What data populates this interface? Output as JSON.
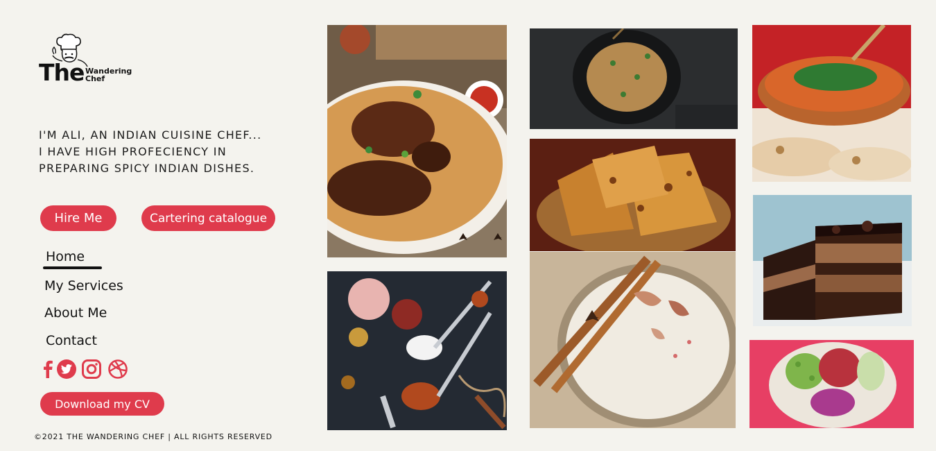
{
  "brand": {
    "line1": "The",
    "line2a": "Wandering",
    "line2b": "Chef"
  },
  "intro": {
    "line1": "I'm Ali, an Indian cuisine chef...",
    "line2": "I have high profeciency in",
    "line3": "preparing spicy Indian dishes."
  },
  "buttons": {
    "hire": "Hire Me",
    "catalogue": "Cartering catalogue",
    "cv": "Download my CV"
  },
  "nav": {
    "home": "Home",
    "services": "My Services",
    "about": "About Me",
    "contact": "Contact",
    "active": "Home"
  },
  "social": [
    "facebook-icon",
    "twitter-icon",
    "instagram-icon",
    "dribbble-icon"
  ],
  "footer": "©2021 The Wandering Chef  | All rights reserved",
  "colors": {
    "accent": "#df3b4c",
    "background": "#f4f3ee",
    "text": "#111111"
  },
  "gallery": [
    "biryani-chicken-photo",
    "spices-spoons-photo",
    "rice-bowl-photo",
    "paratha-basket-photo",
    "kheer-cinnamon-photo",
    "curry-naan-photo",
    "chocolate-cake-photo",
    "poke-bowl-photo"
  ]
}
